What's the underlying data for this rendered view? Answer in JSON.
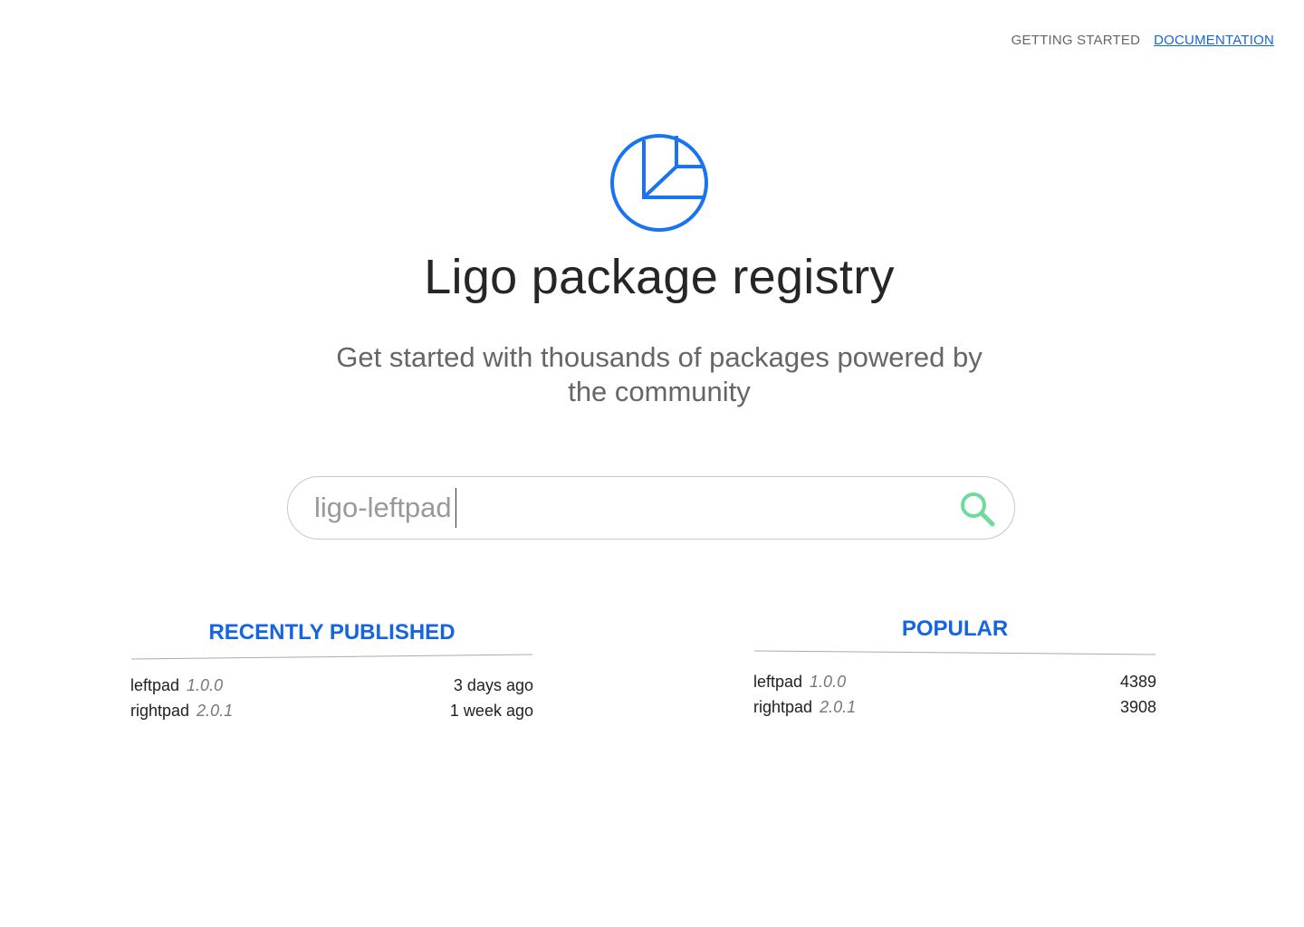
{
  "nav": {
    "getting_started": "GETTING STARTED",
    "documentation": "DOCUMENTATION"
  },
  "logo_icon": "pie-chart-icon",
  "title": "Ligo package registry",
  "subtitle": "Get started with thousands of packages powered by the community",
  "search": {
    "value": "ligo-leftpad",
    "icon": "search-icon"
  },
  "recent": {
    "title": "RECENTLY PUBLISHED",
    "items": [
      {
        "name": "leftpad",
        "version": "1.0.0",
        "when": "3 days ago"
      },
      {
        "name": "rightpad",
        "version": "2.0.1",
        "when": "1 week ago"
      }
    ]
  },
  "popular": {
    "title": "POPULAR",
    "items": [
      {
        "name": "leftpad",
        "version": "1.0.0",
        "count": "4389"
      },
      {
        "name": "rightpad",
        "version": "2.0.1",
        "count": "3908"
      }
    ]
  },
  "colors": {
    "accent": "#1565e0",
    "logo": "#1a73f0",
    "search_icon": "#6fdb9b",
    "muted_text": "#666666"
  }
}
